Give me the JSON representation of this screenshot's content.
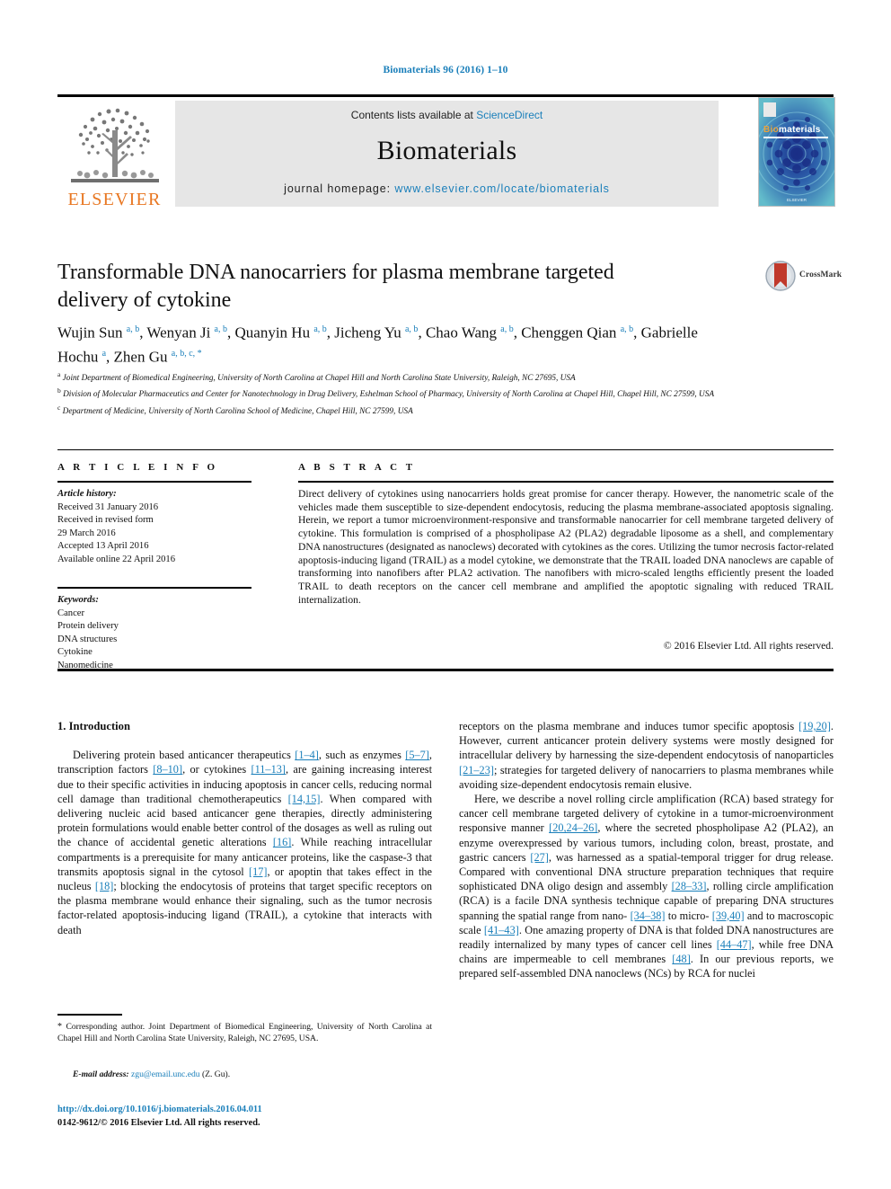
{
  "running_head": "Biomaterials 96 (2016) 1–10",
  "masthead": {
    "publisher_logo_text": "ELSEVIER",
    "contents_prefix": "Contents lists available at ",
    "contents_link": "ScienceDirect",
    "journal_name": "Biomaterials",
    "homepage_label": "journal homepage: ",
    "homepage_url": "www.elsevier.com/locate/biomaterials",
    "cover": {
      "title_bio": "Bio",
      "title_materials": "materials",
      "footer": "ELSEVIER"
    }
  },
  "article": {
    "title": "Transformable DNA nanocarriers for plasma membrane targeted delivery of cytokine",
    "crossmark_label": "CrossMark",
    "authors": [
      {
        "name": "Wujin Sun",
        "marks": "a, b",
        "sep": ", "
      },
      {
        "name": "Wenyan Ji",
        "marks": "a, b",
        "sep": ", "
      },
      {
        "name": "Quanyin Hu",
        "marks": "a, b",
        "sep": ", "
      },
      {
        "name": "Jicheng Yu",
        "marks": "a, b",
        "sep": ", "
      },
      {
        "name": "Chao Wang",
        "marks": "a, b",
        "sep": ", "
      },
      {
        "name": "Chenggen Qian",
        "marks": "a, b",
        "sep": ", "
      },
      {
        "name": "Gabrielle Hochu",
        "marks": "a",
        "sep": ", "
      },
      {
        "name": "Zhen Gu",
        "marks": "a, b, c, *",
        "sep": ""
      }
    ],
    "affiliations": [
      {
        "mark": "a",
        "text": "Joint Department of Biomedical Engineering, University of North Carolina at Chapel Hill and North Carolina State University, Raleigh, NC 27695, USA"
      },
      {
        "mark": "b",
        "text": "Division of Molecular Pharmaceutics and Center for Nanotechnology in Drug Delivery, Eshelman School of Pharmacy, University of North Carolina at Chapel Hill, Chapel Hill, NC 27599, USA"
      },
      {
        "mark": "c",
        "text": "Department of Medicine, University of North Carolina School of Medicine, Chapel Hill, NC 27599, USA"
      }
    ]
  },
  "article_info": {
    "header": "A R T I C L E   I N F O",
    "history_label": "Article history:",
    "history": [
      "Received 31 January 2016",
      "Received in revised form",
      "29 March 2016",
      "Accepted 13 April 2016",
      "Available online 22 April 2016"
    ],
    "keywords_label": "Keywords:",
    "keywords": [
      "Cancer",
      "Protein delivery",
      "DNA structures",
      "Cytokine",
      "Nanomedicine"
    ]
  },
  "abstract": {
    "header": "A B S T R A C T",
    "text": "Direct delivery of cytokines using nanocarriers holds great promise for cancer therapy. However, the nanometric scale of the vehicles made them susceptible to size-dependent endocytosis, reducing the plasma membrane-associated apoptosis signaling. Herein, we report a tumor microenvironment-responsive and transformable nanocarrier for cell membrane targeted delivery of cytokine. This formulation is comprised of a phospholipase A2 (PLA2) degradable liposome as a shell, and complementary DNA nanostructures (designated as nanoclews) decorated with cytokines as the cores. Utilizing the tumor necrosis factor-related apoptosis-inducing ligand (TRAIL) as a model cytokine, we demonstrate that the TRAIL loaded DNA nanoclews are capable of transforming into nanofibers after PLA2 activation. The nanofibers with micro-scaled lengths efficiently present the loaded TRAIL to death receptors on the cancer cell membrane and amplified the apoptotic signaling with reduced TRAIL internalization.",
    "copyright": "© 2016 Elsevier Ltd. All rights reserved."
  },
  "body": {
    "section_heading": "1. Introduction",
    "left_paragraphs": [
      "Delivering protein based anticancer therapeutics [1–4], such as enzymes [5–7], transcription factors [8–10], or cytokines [11–13], are gaining increasing interest due to their specific activities in inducing apoptosis in cancer cells, reducing normal cell damage than traditional chemotherapeutics [14,15]. When compared with delivering nucleic acid based anticancer gene therapies, directly administering protein formulations would enable better control of the dosages as well as ruling out the chance of accidental genetic alterations [16]. While reaching intracellular compartments is a prerequisite for many anticancer proteins, like the caspase-3 that transmits apoptosis signal in the cytosol [17], or apoptin that takes effect in the nucleus [18]; blocking the endocytosis of proteins that target specific receptors on the plasma membrane would enhance their signaling, such as the tumor necrosis factor-related apoptosis-inducing ligand (TRAIL), a cytokine that interacts with death"
    ],
    "right_paragraphs": [
      "receptors on the plasma membrane and induces tumor specific apoptosis [19,20]. However, current anticancer protein delivery systems were mostly designed for intracellular delivery by harnessing the size-dependent endocytosis of nanoparticles [21–23]; strategies for targeted delivery of nanocarriers to plasma membranes while avoiding size-dependent endocytosis remain elusive.",
      "Here, we describe a novel rolling circle amplification (RCA) based strategy for cancer cell membrane targeted delivery of cytokine in a tumor-microenvironment responsive manner [20,24–26], where the secreted phospholipase A2 (PLA2), an enzyme overexpressed by various tumors, including colon, breast, prostate, and gastric cancers [27], was harnessed as a spatial-temporal trigger for drug release. Compared with conventional DNA structure preparation techniques that require sophisticated DNA oligo design and assembly [28–33], rolling circle amplification (RCA) is a facile DNA synthesis technique capable of preparing DNA structures spanning the spatial range from nano- [34–38] to micro- [39,40] and to macroscopic scale [41–43]. One amazing property of DNA is that folded DNA nanostructures are readily internalized by many types of cancer cell lines [44–47], while free DNA chains are impermeable to cell membranes [48]. In our previous reports, we prepared self-assembled DNA nanoclews (NCs) by RCA for nuclei"
    ]
  },
  "footer": {
    "corresponding_note": "Corresponding author. Joint Department of Biomedical Engineering, University of North Carolina at Chapel Hill and North Carolina State University, Raleigh, NC 27695, USA.",
    "email_label": "E-mail address:",
    "email": "zgu@email.unc.edu",
    "email_suffix": "(Z. Gu).",
    "doi": "http://dx.doi.org/10.1016/j.biomaterials.2016.04.011",
    "issn_line": "0142-9612/© 2016 Elsevier Ltd. All rights reserved."
  },
  "colors": {
    "link": "#1a7fba",
    "elsevier_orange": "#e87722",
    "masthead_gray": "#e6e6e6"
  }
}
